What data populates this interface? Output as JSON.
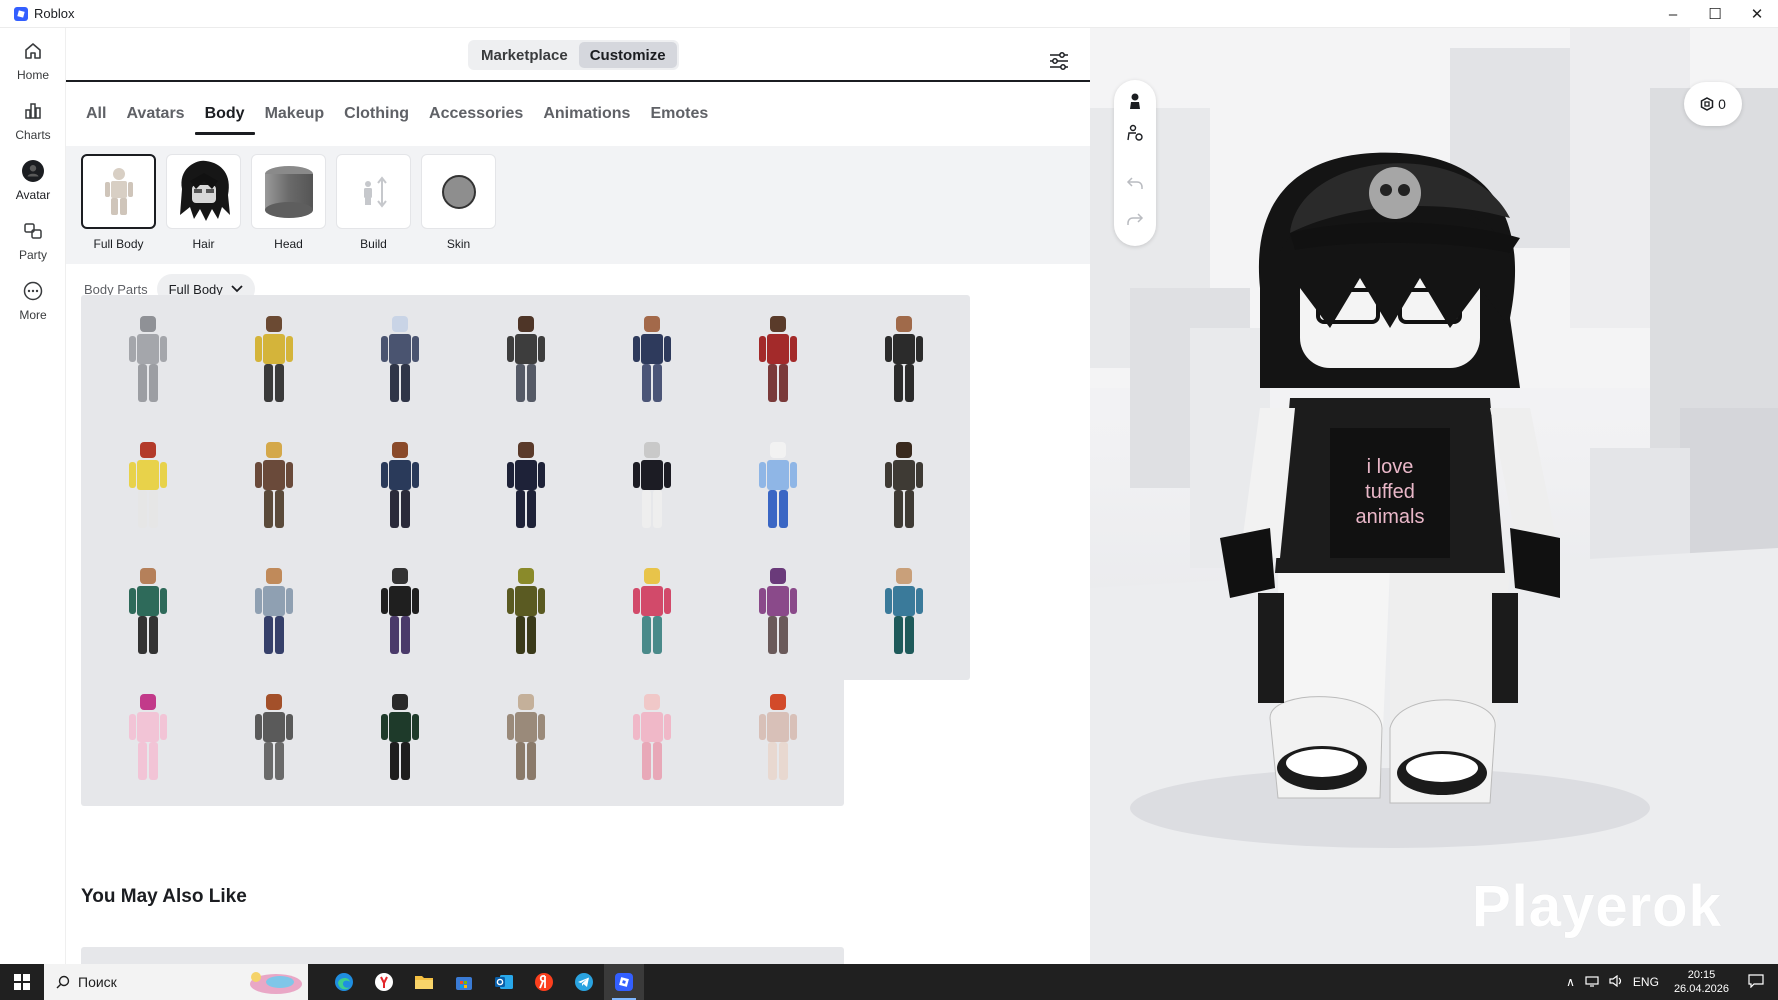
{
  "window": {
    "title": "Roblox",
    "controls": [
      "–",
      "☐",
      "✕"
    ]
  },
  "rail": [
    {
      "label": "Home",
      "icon": "home-icon"
    },
    {
      "label": "Charts",
      "icon": "chart-icon"
    },
    {
      "label": "Avatar",
      "icon": "avatar-icon",
      "active": true
    },
    {
      "label": "Party",
      "icon": "party-icon"
    },
    {
      "label": "More",
      "icon": "more-icon"
    }
  ],
  "segment": {
    "marketplace": "Marketplace",
    "customize": "Customize",
    "active": "Customize"
  },
  "tabs": [
    "All",
    "Avatars",
    "Body",
    "Makeup",
    "Clothing",
    "Accessories",
    "Animations",
    "Emotes"
  ],
  "active_tab": "Body",
  "subcategories": [
    {
      "label": "Full Body",
      "active": true
    },
    {
      "label": "Hair"
    },
    {
      "label": "Head"
    },
    {
      "label": "Build"
    },
    {
      "label": "Skin"
    }
  ],
  "filter": {
    "label": "Body Parts",
    "value": "Full Body"
  },
  "items": [
    {
      "head": "#8f9196",
      "torso": "#a4a6ab",
      "legs": "#9c9ea3"
    },
    {
      "head": "#6b4a33",
      "torso": "#d4b43a",
      "legs": "#3a3a3a"
    },
    {
      "head": "#c9d4e6",
      "torso": "#4a5470",
      "legs": "#2f3548"
    },
    {
      "head": "#4e3527",
      "torso": "#3d3d3d",
      "legs": "#555a66"
    },
    {
      "head": "#a3694a",
      "torso": "#2e3a5c",
      "legs": "#4b5577"
    },
    {
      "head": "#5a3b2a",
      "torso": "#a32a2a",
      "legs": "#7a3a3a"
    },
    {
      "head": "#a06a4a",
      "torso": "#2b2b2b",
      "legs": "#2b2b2b"
    },
    {
      "head": "#b33a2a",
      "torso": "#e8d24a",
      "legs": "#e6e6e6"
    },
    {
      "head": "#d4a84a",
      "torso": "#6a4a3a",
      "legs": "#5a4a3a"
    },
    {
      "head": "#8a4a2a",
      "torso": "#2a3a5a",
      "legs": "#2a2a3a"
    },
    {
      "head": "#5a3a2a",
      "torso": "#1e2238",
      "legs": "#1e2238"
    },
    {
      "head": "#c9c9c9",
      "torso": "#1c1c24",
      "legs": "#eeeeee"
    },
    {
      "head": "#f2f2f2",
      "torso": "#8fb6e6",
      "legs": "#3a66c4"
    },
    {
      "head": "#3a2a1e",
      "torso": "#3e3a34",
      "legs": "#3e3a34"
    },
    {
      "head": "#b5805a",
      "torso": "#2e6a5a",
      "legs": "#333333"
    },
    {
      "head": "#c08a5a",
      "torso": "#8fa0b2",
      "legs": "#36406a"
    },
    {
      "head": "#333333",
      "torso": "#1f1f1f",
      "legs": "#4a3a6a"
    },
    {
      "head": "#8a8a2a",
      "torso": "#5a5a22",
      "legs": "#3a3a1a"
    },
    {
      "head": "#e8c44a",
      "torso": "#d24a6a",
      "legs": "#4a8a8a"
    },
    {
      "head": "#6a3a7a",
      "torso": "#8a4a8a",
      "legs": "#6a5a5a"
    },
    {
      "head": "#c9a07a",
      "torso": "#3a7a9a",
      "legs": "#1e5a5a"
    },
    {
      "head": "#c23a8a",
      "torso": "#f2c4d6",
      "legs": "#f2c4d6"
    },
    {
      "head": "#a3502a",
      "torso": "#5a5a5a",
      "legs": "#6a6a6a"
    },
    {
      "head": "#2a2a2a",
      "torso": "#1e3a2a",
      "legs": "#1e1e1e"
    },
    {
      "head": "#c4b09a",
      "torso": "#9a8a7a",
      "legs": "#8a7a6a"
    },
    {
      "head": "#f0c8c8",
      "torso": "#f0b8c8",
      "legs": "#e8a8b8"
    },
    {
      "head": "#d24a2a",
      "torso": "#d8c0b8",
      "legs": "#e8d8d0"
    }
  ],
  "recommended": {
    "title": "You May Also Like",
    "items": [
      "#7a6ae6",
      "#d8d8e8",
      "#8a8ad8",
      "#222222",
      "#6a5a3a",
      "#e8e8f2"
    ]
  },
  "viewport": {
    "robux": "0",
    "watermark": "Playerok"
  },
  "taskbar": {
    "search_placeholder": "Поиск",
    "apps": [
      "edge",
      "yandex-browser",
      "file-explorer",
      "store",
      "outlook",
      "yandex",
      "telegram",
      "roblox"
    ],
    "tray": {
      "lang": "ENG",
      "time": "20:15",
      "date": "26.04.2026"
    }
  },
  "colors": {
    "accent": "#335fff",
    "text": "#1b1d21",
    "tile": "#e6e7ea",
    "band": "#f2f3f5"
  }
}
